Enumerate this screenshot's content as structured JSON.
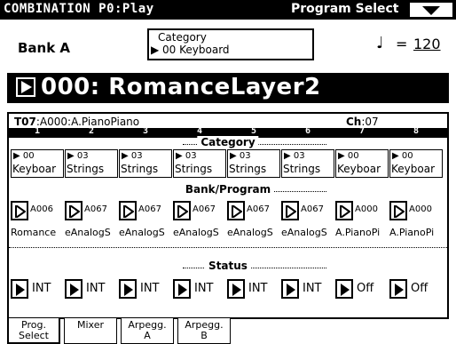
{
  "titlebar": {
    "mode": "COMBINATION P0:Play",
    "page": "Program Select"
  },
  "header": {
    "bank": "Bank A",
    "category_label": "Category",
    "category_value": "▶ 00 Keyboard",
    "tempo_symbol": "♩",
    "tempo_eq": "=",
    "tempo_value": "120"
  },
  "combination": {
    "name": "000: RomanceLayer2"
  },
  "timbre": {
    "selected": "T07",
    "program": ":A000:A.PianoPiano",
    "ch_label": "Ch",
    "ch_value": ":07"
  },
  "timbre_numbers": [
    "1",
    "2",
    "3",
    "4",
    "5",
    "6",
    "7",
    "8"
  ],
  "sections": {
    "category": "Category",
    "bank_program": "Bank/Program",
    "status": "Status"
  },
  "categories": [
    {
      "num": "▶ 00",
      "name": "Keyboar"
    },
    {
      "num": "▶ 03",
      "name": "Strings"
    },
    {
      "num": "▶ 03",
      "name": "Strings"
    },
    {
      "num": "▶ 03",
      "name": "Strings"
    },
    {
      "num": "▶ 03",
      "name": "Strings"
    },
    {
      "num": "▶ 03",
      "name": "Strings"
    },
    {
      "num": "▶ 00",
      "name": "Keyboar"
    },
    {
      "num": "▶ 00",
      "name": "Keyboar"
    }
  ],
  "programs": [
    {
      "bank": "A006",
      "name": "Romance"
    },
    {
      "bank": "A067",
      "name": "eAnalogS"
    },
    {
      "bank": "A067",
      "name": "eAnalogS"
    },
    {
      "bank": "A067",
      "name": "eAnalogS"
    },
    {
      "bank": "A067",
      "name": "eAnalogS"
    },
    {
      "bank": "A067",
      "name": "eAnalogS"
    },
    {
      "bank": "A000",
      "name": "A.PianoPi"
    },
    {
      "bank": "A000",
      "name": "A.PianoPi"
    }
  ],
  "status": [
    "INT",
    "INT",
    "INT",
    "INT",
    "INT",
    "INT",
    "Off",
    "Off"
  ],
  "tabs": [
    {
      "line1": "Prog.",
      "line2": "Select"
    },
    {
      "line1": "Mixer",
      "line2": ""
    },
    {
      "line1": "Arpegg.",
      "line2": "A"
    },
    {
      "line1": "Arpegg.",
      "line2": "B"
    }
  ]
}
